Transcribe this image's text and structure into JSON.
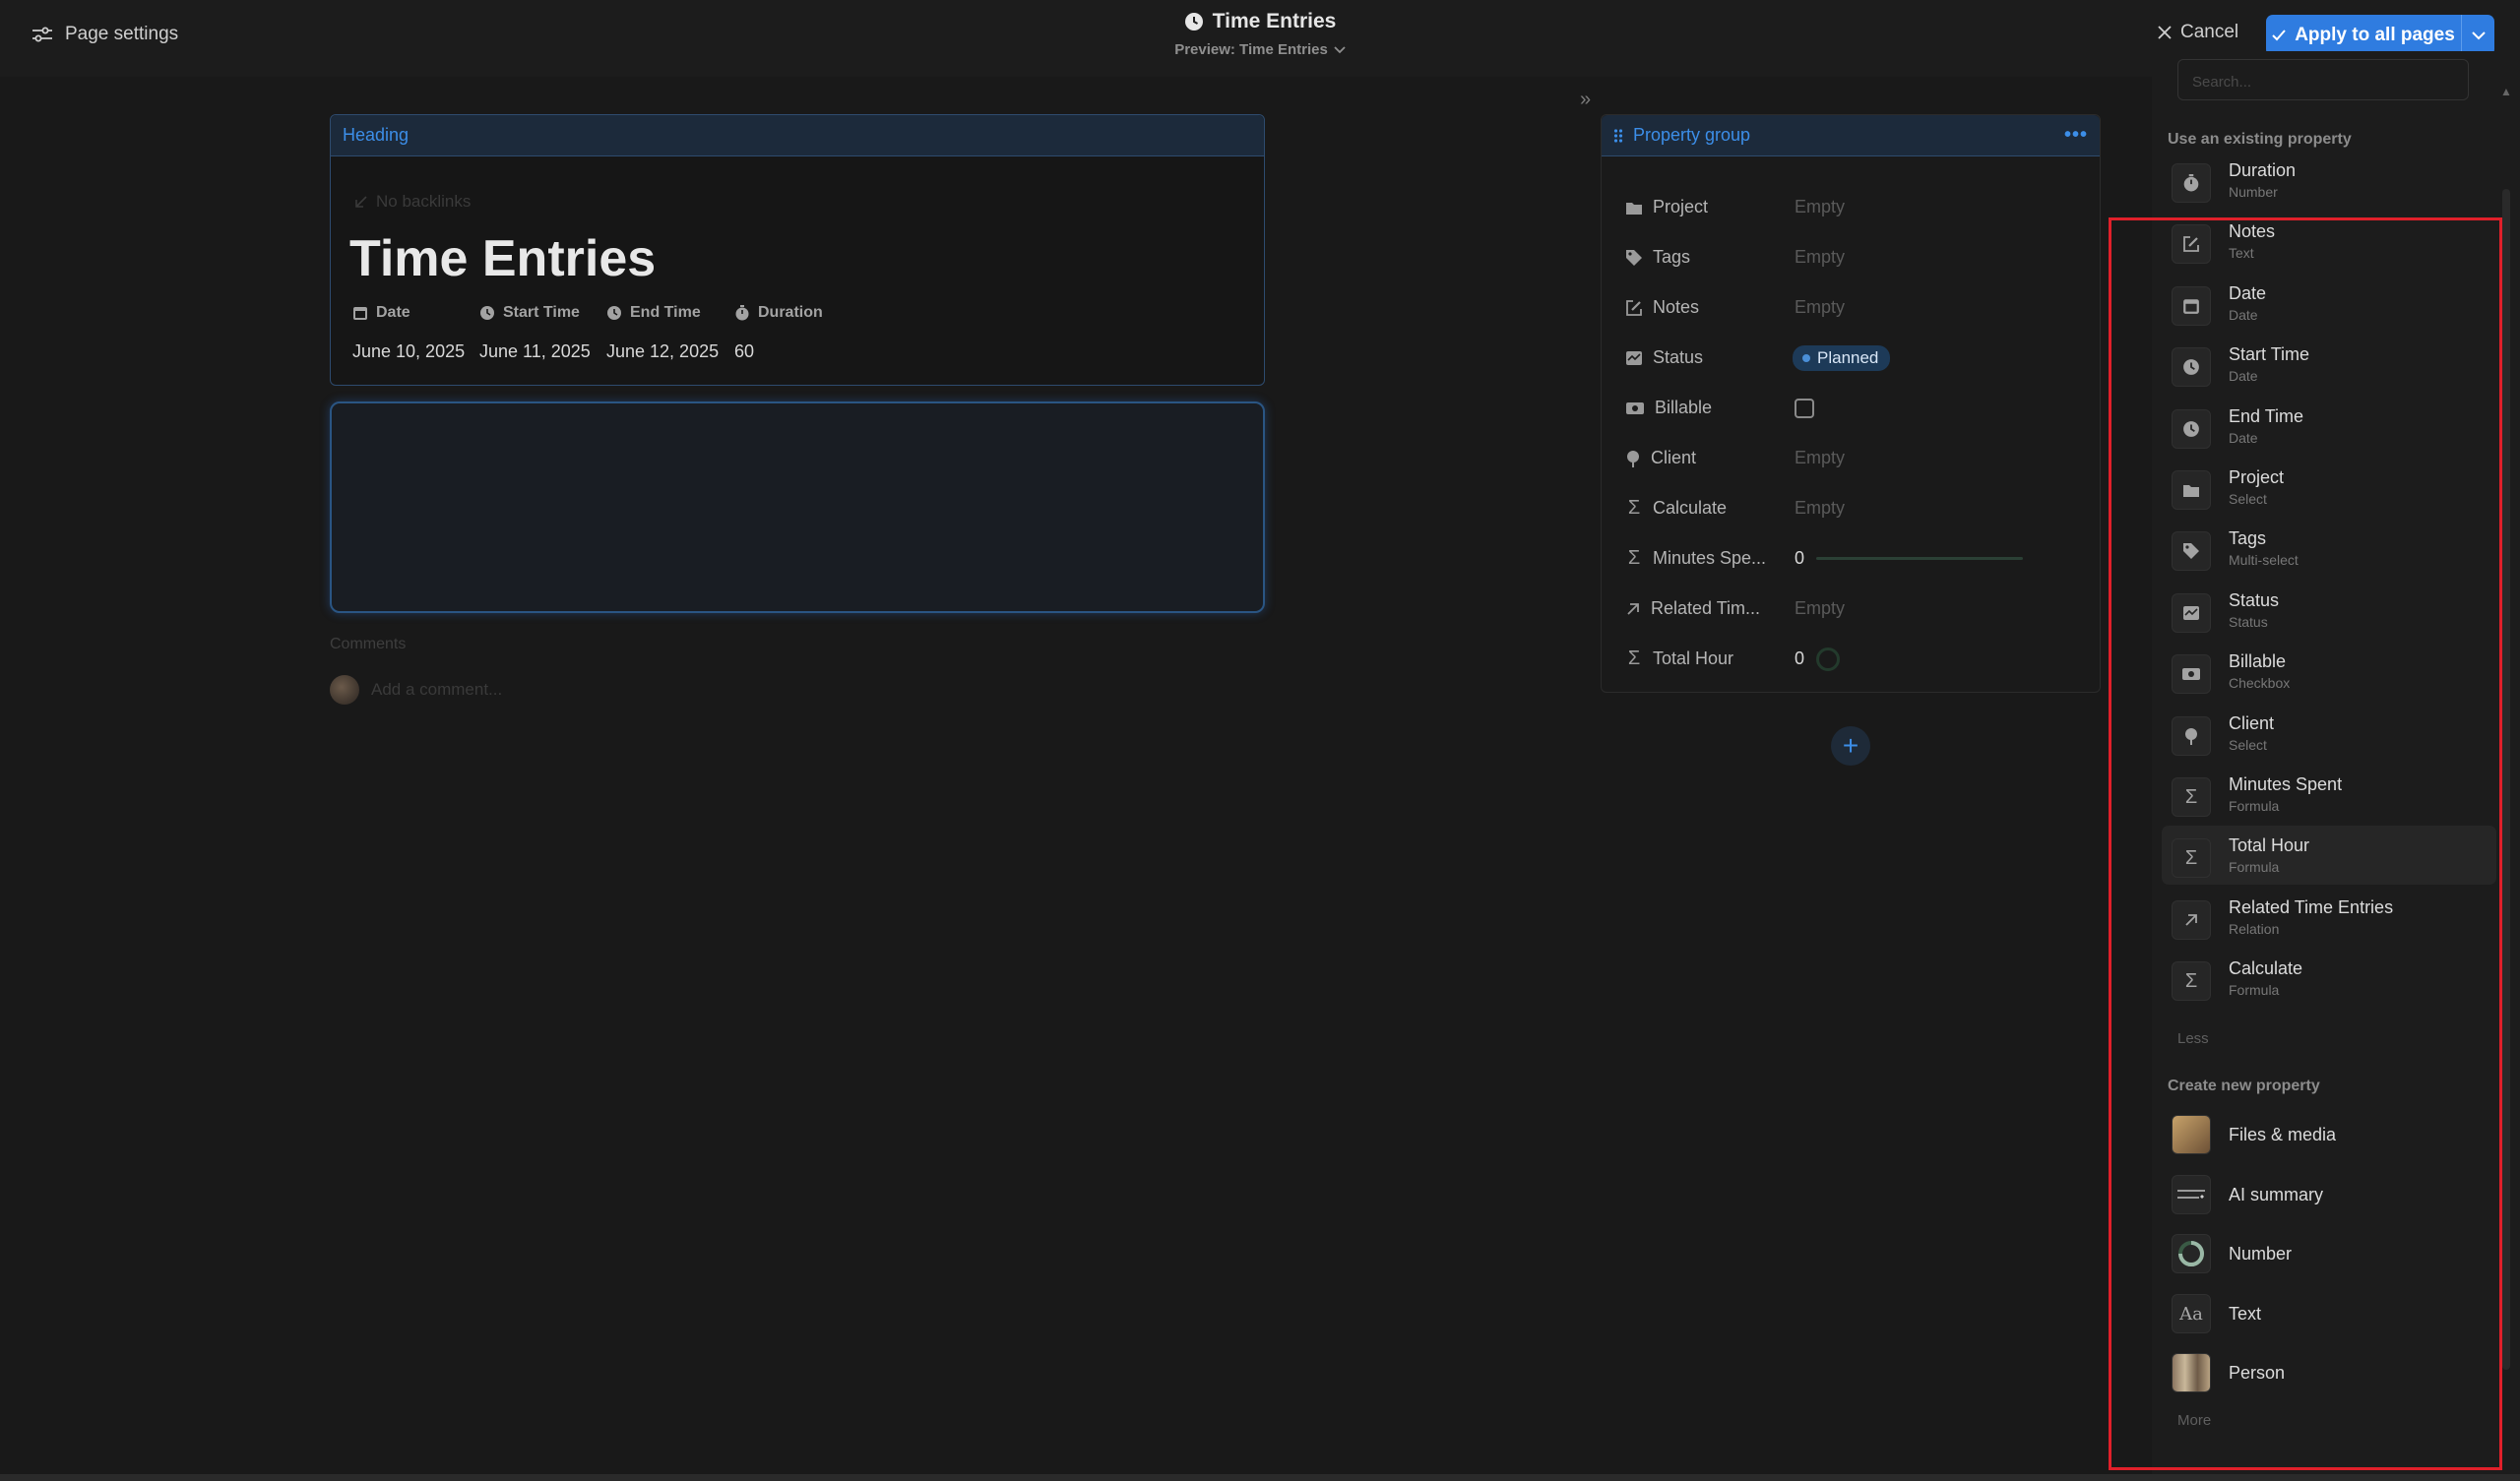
{
  "topbar": {
    "page_settings": "Page settings",
    "title": "Time Entries",
    "preview": "Preview: Time Entries",
    "cancel": "Cancel",
    "apply": "Apply to all pages"
  },
  "heading_card": {
    "label": "Heading",
    "backlinks": "No backlinks",
    "title": "Time Entries",
    "properties": [
      {
        "name": "Date",
        "value": "June 10, 2025",
        "icon": "calendar-icon"
      },
      {
        "name": "Start Time",
        "value": "June 11, 2025",
        "icon": "clock-icon"
      },
      {
        "name": "End Time",
        "value": "June 12, 2025",
        "icon": "clock-icon"
      },
      {
        "name": "Duration",
        "value": "60",
        "icon": "stopwatch-icon"
      }
    ]
  },
  "comments": {
    "label": "Comments",
    "placeholder": "Add a comment..."
  },
  "property_group": {
    "label": "Property group",
    "rows": [
      {
        "name": "Project",
        "value": "Empty",
        "icon": "folder-icon"
      },
      {
        "name": "Tags",
        "value": "Empty",
        "icon": "tag-icon"
      },
      {
        "name": "Notes",
        "value": "Empty",
        "icon": "edit-icon"
      },
      {
        "name": "Status",
        "value": "Planned",
        "icon": "status-icon"
      },
      {
        "name": "Billable",
        "value": "",
        "icon": "money-icon"
      },
      {
        "name": "Client",
        "value": "Empty",
        "icon": "pin-icon"
      },
      {
        "name": "Calculate",
        "value": "Empty",
        "icon": "sigma-icon"
      },
      {
        "name": "Minutes Spe...",
        "value": "0",
        "icon": "sigma-icon"
      },
      {
        "name": "Related Tim...",
        "value": "Empty",
        "icon": "arrow-up-right-icon"
      },
      {
        "name": "Total Hour",
        "value": "0",
        "icon": "sigma-icon"
      }
    ],
    "billable_checked": false,
    "minutes_progress": 0,
    "total_hour_progress": 0
  },
  "sidebar": {
    "search_placeholder": "Search...",
    "existing_label": "Use an existing property",
    "existing": [
      {
        "name": "Duration",
        "type": "Number",
        "icon": "stopwatch-icon"
      },
      {
        "name": "Notes",
        "type": "Text",
        "icon": "edit-icon"
      },
      {
        "name": "Date",
        "type": "Date",
        "icon": "calendar-icon"
      },
      {
        "name": "Start Time",
        "type": "Date",
        "icon": "clock-icon"
      },
      {
        "name": "End Time",
        "type": "Date",
        "icon": "clock-icon"
      },
      {
        "name": "Project",
        "type": "Select",
        "icon": "folder-icon"
      },
      {
        "name": "Tags",
        "type": "Multi-select",
        "icon": "tag-icon"
      },
      {
        "name": "Status",
        "type": "Status",
        "icon": "status-icon"
      },
      {
        "name": "Billable",
        "type": "Checkbox",
        "icon": "money-icon"
      },
      {
        "name": "Client",
        "type": "Select",
        "icon": "pin-icon"
      },
      {
        "name": "Minutes Spent",
        "type": "Formula",
        "icon": "sigma-icon"
      },
      {
        "name": "Total Hour",
        "type": "Formula",
        "icon": "sigma-icon"
      },
      {
        "name": "Related Time Entries",
        "type": "Relation",
        "icon": "arrow-up-right-icon"
      },
      {
        "name": "Calculate",
        "type": "Formula",
        "icon": "sigma-icon"
      }
    ],
    "less_label": "Less",
    "create_label": "Create new property",
    "create": [
      {
        "name": "Files & media",
        "icon": "files-media-icon"
      },
      {
        "name": "AI summary",
        "icon": "ai-summary-icon"
      },
      {
        "name": "Number",
        "icon": "number-ring-icon"
      },
      {
        "name": "Text",
        "icon": "text-aa-icon"
      },
      {
        "name": "Person",
        "icon": "person-icon"
      }
    ],
    "more_label": "More"
  },
  "colors": {
    "accent": "#2f7ce0",
    "highlight_box": "#e0202a",
    "background": "#191919"
  }
}
